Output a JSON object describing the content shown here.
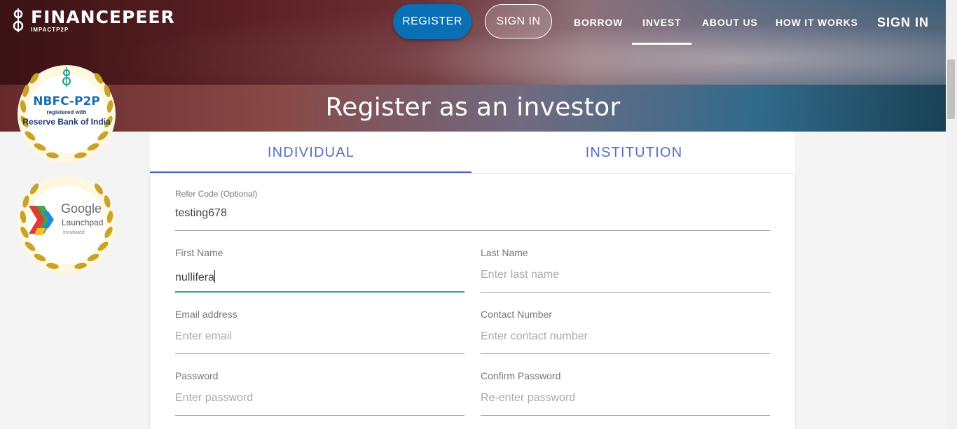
{
  "header": {
    "brand": "FINANCEPEER",
    "brand_sub": "IMPACTP2P",
    "register_button": "REGISTER",
    "signin_button": "SIGN IN",
    "nav": [
      "BORROW",
      "INVEST",
      "ABOUT US",
      "HOW IT WORKS"
    ],
    "nav_active": "INVEST",
    "nav_signin": "SIGN IN"
  },
  "hero": {
    "title": "Register as an investor"
  },
  "badges": {
    "nbfc_title": "NBFC-P2P",
    "nbfc_registered": "registered with",
    "nbfc_rbi": "Reserve Bank of India",
    "google": "Google",
    "launchpad": "Launchpad",
    "incubated": "Incubated"
  },
  "tabs": {
    "individual": "INDIVIDUAL",
    "institution": "INSTITUTION",
    "active": "INDIVIDUAL"
  },
  "form": {
    "refer_code": {
      "label": "Refer Code (Optional)",
      "value": "testing678"
    },
    "first_name": {
      "label": "First Name",
      "value": "nullifera"
    },
    "last_name": {
      "label": "Last Name",
      "placeholder": "Enter last name"
    },
    "email": {
      "label": "Email address",
      "placeholder": "Enter email"
    },
    "contact": {
      "label": "Contact Number",
      "placeholder": "Enter contact number"
    },
    "password": {
      "label": "Password",
      "placeholder": "Enter password"
    },
    "confirm_password": {
      "label": "Confirm Password",
      "placeholder": "Re-enter password"
    }
  },
  "colors": {
    "accent_blue": "#0a6fb5",
    "tab_text": "#5a6fc0",
    "active_field_line": "#1ea3b0"
  }
}
